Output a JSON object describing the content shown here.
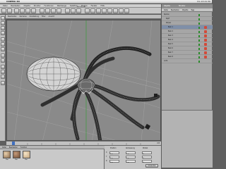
{
  "macbar": {
    "app_name": "CINEMA 4D",
    "right_status": "Do 13:21:30"
  },
  "window": {
    "title": "spinne.c4d"
  },
  "menubar": {
    "items": [
      "Datei",
      "Bearbeiten",
      "Objekte",
      "Struktur",
      "Funktionen",
      "Werkzeuge",
      "Selektion",
      "Plugins",
      "Fenster",
      "Hilfe"
    ]
  },
  "viewport_menu": {
    "items": [
      "Bearbeiten",
      "Kameras",
      "Darstellung",
      "Filter",
      "Ansicht"
    ]
  },
  "right_panel": {
    "tabs": [
      "Objekte",
      "Struktur"
    ],
    "header_items": [
      "Datei",
      "Bearbeiten",
      "Objekte",
      "Tags"
    ],
    "rows": [
      "Spinne",
      "Kopf",
      "Körper",
      "Bein 1",
      "Bein 2",
      "Bein 3",
      "Bein 4",
      "Bein 5",
      "Bein 6",
      "Bein 7",
      "Bein 8",
      "Licht"
    ]
  },
  "timeline": {
    "frame_label": "0 B"
  },
  "materials": {
    "menu": [
      "Datei",
      "Bearbeiten",
      "Funktion"
    ],
    "swatches": [
      {
        "label": "Mat",
        "color": "#8a6a4a"
      },
      {
        "label": "Mat",
        "color": "#6e4c34"
      },
      {
        "label": "Mat",
        "color": "#c2a27a"
      }
    ]
  },
  "coordinates": {
    "headers": [
      "Position",
      "Abmessung",
      "Winkel"
    ],
    "rows": [
      {
        "axis": "X",
        "values": [
          "0 m",
          "0 m",
          "0°"
        ]
      },
      {
        "axis": "Y",
        "values": [
          "0 m",
          "0 m",
          "0°"
        ]
      },
      {
        "axis": "Z",
        "values": [
          "0 m",
          "0 m",
          "0°"
        ]
      }
    ],
    "apply_label": "Anwenden"
  },
  "colors": {
    "viewport_bg": "#8a8a8a",
    "selection": "#7f8fa8"
  }
}
